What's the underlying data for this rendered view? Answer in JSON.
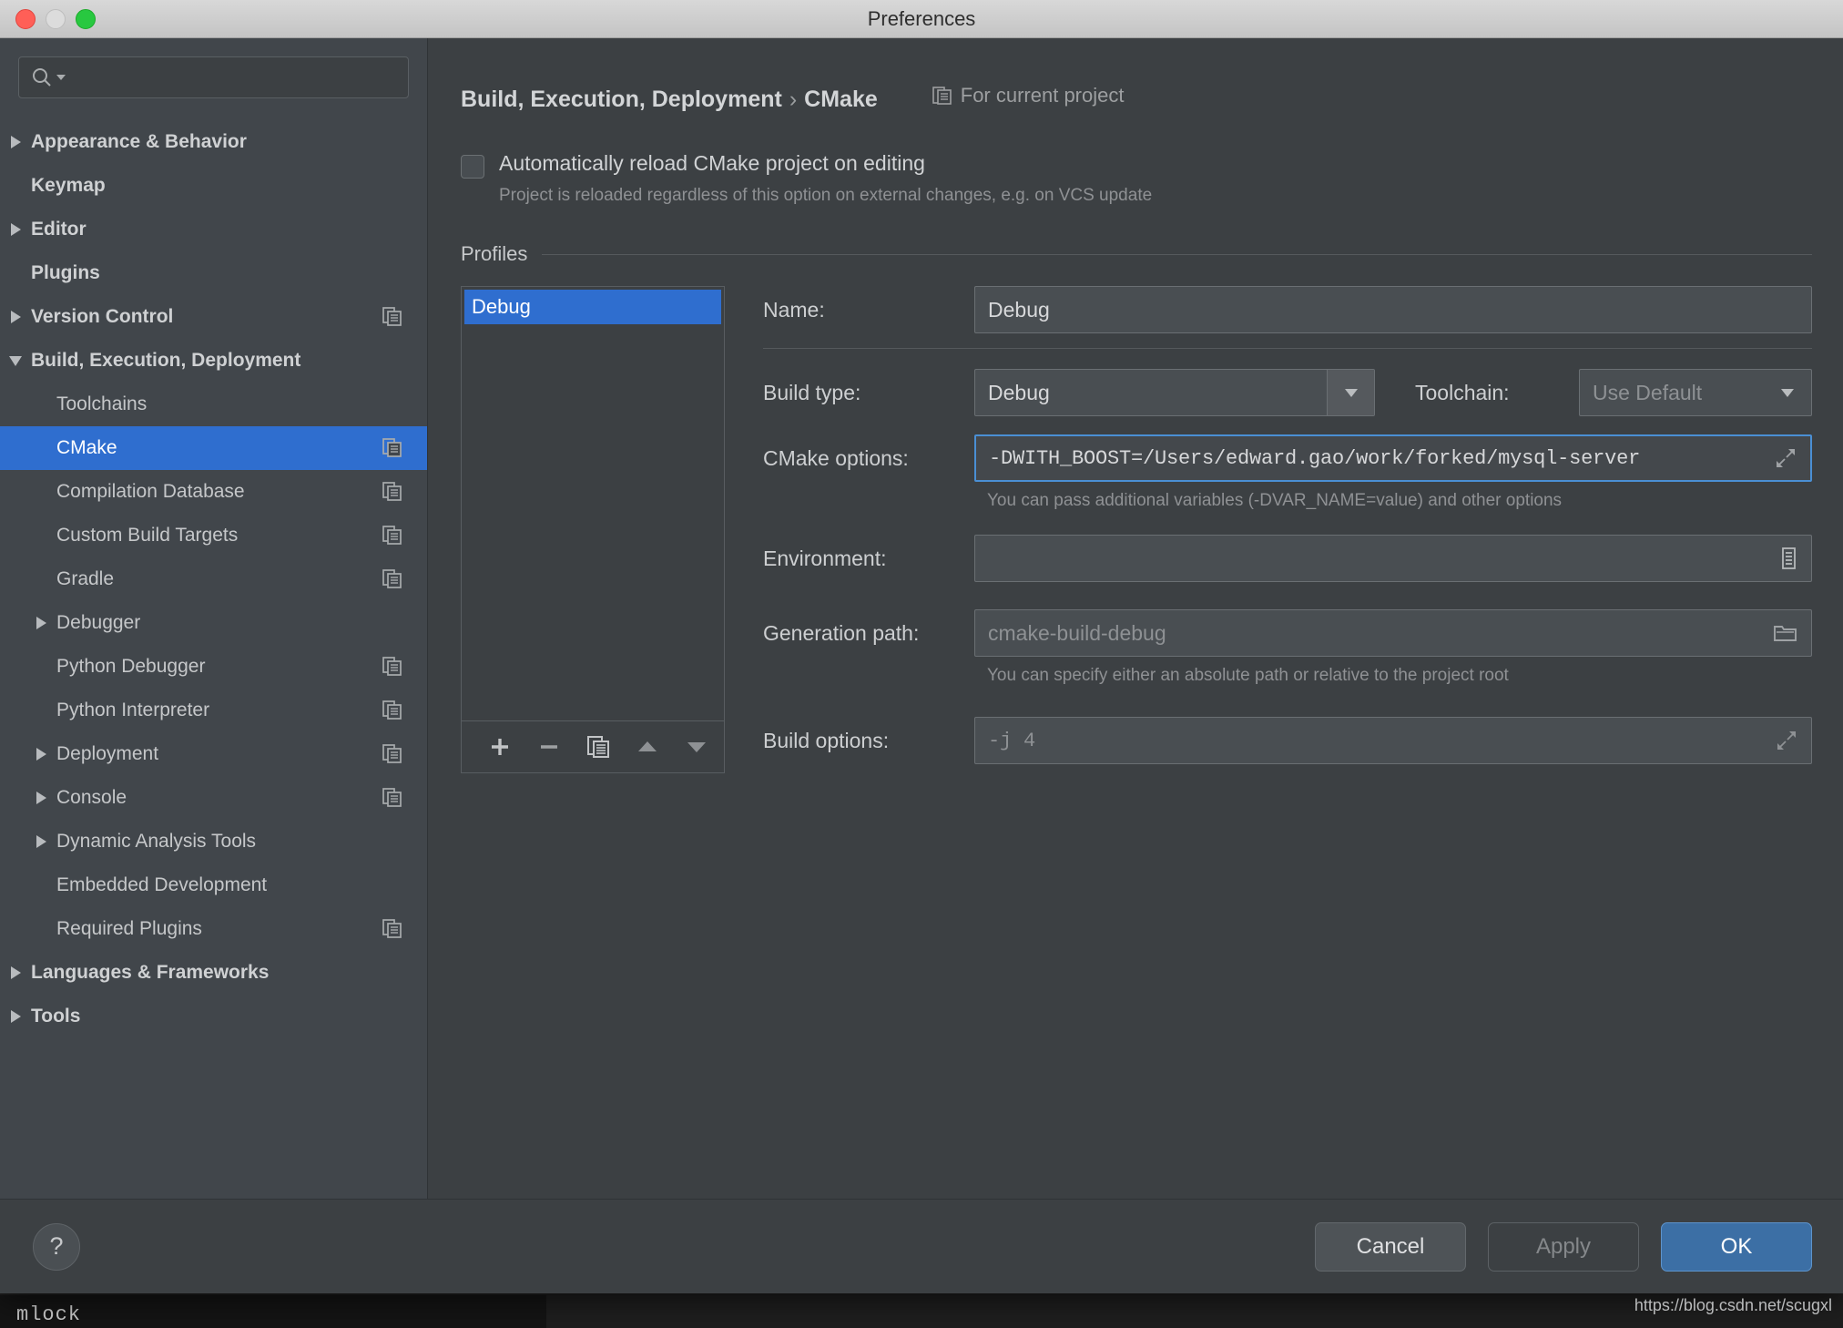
{
  "window": {
    "title": "Preferences",
    "traffic_lights": [
      "close",
      "minimize",
      "zoom"
    ]
  },
  "search": {
    "value": "",
    "placeholder": ""
  },
  "sidebar": {
    "items": [
      {
        "label": "Appearance & Behavior",
        "level": 0,
        "twisty": "right",
        "bold": true,
        "copy": false,
        "selected": false
      },
      {
        "label": "Keymap",
        "level": 0,
        "twisty": "none",
        "bold": true,
        "copy": false,
        "selected": false
      },
      {
        "label": "Editor",
        "level": 0,
        "twisty": "right",
        "bold": true,
        "copy": false,
        "selected": false
      },
      {
        "label": "Plugins",
        "level": 0,
        "twisty": "none",
        "bold": true,
        "copy": false,
        "selected": false
      },
      {
        "label": "Version Control",
        "level": 0,
        "twisty": "right",
        "bold": true,
        "copy": true,
        "selected": false
      },
      {
        "label": "Build, Execution, Deployment",
        "level": 0,
        "twisty": "down",
        "bold": true,
        "copy": false,
        "selected": false
      },
      {
        "label": "Toolchains",
        "level": 1,
        "twisty": "none",
        "bold": false,
        "copy": false,
        "selected": false
      },
      {
        "label": "CMake",
        "level": 1,
        "twisty": "none",
        "bold": false,
        "copy": true,
        "selected": true
      },
      {
        "label": "Compilation Database",
        "level": 1,
        "twisty": "none",
        "bold": false,
        "copy": true,
        "selected": false
      },
      {
        "label": "Custom Build Targets",
        "level": 1,
        "twisty": "none",
        "bold": false,
        "copy": true,
        "selected": false
      },
      {
        "label": "Gradle",
        "level": 1,
        "twisty": "none",
        "bold": false,
        "copy": true,
        "selected": false
      },
      {
        "label": "Debugger",
        "level": 1,
        "twisty": "right",
        "bold": false,
        "copy": false,
        "selected": false
      },
      {
        "label": "Python Debugger",
        "level": 1,
        "twisty": "none",
        "bold": false,
        "copy": true,
        "selected": false
      },
      {
        "label": "Python Interpreter",
        "level": 1,
        "twisty": "none",
        "bold": false,
        "copy": true,
        "selected": false
      },
      {
        "label": "Deployment",
        "level": 1,
        "twisty": "right",
        "bold": false,
        "copy": true,
        "selected": false
      },
      {
        "label": "Console",
        "level": 1,
        "twisty": "right",
        "bold": false,
        "copy": true,
        "selected": false
      },
      {
        "label": "Dynamic Analysis Tools",
        "level": 1,
        "twisty": "right",
        "bold": false,
        "copy": false,
        "selected": false
      },
      {
        "label": "Embedded Development",
        "level": 1,
        "twisty": "none",
        "bold": false,
        "copy": false,
        "selected": false
      },
      {
        "label": "Required Plugins",
        "level": 1,
        "twisty": "none",
        "bold": false,
        "copy": true,
        "selected": false
      },
      {
        "label": "Languages & Frameworks",
        "level": 0,
        "twisty": "right",
        "bold": true,
        "copy": false,
        "selected": false
      },
      {
        "label": "Tools",
        "level": 0,
        "twisty": "right",
        "bold": true,
        "copy": false,
        "selected": false
      }
    ]
  },
  "main": {
    "breadcrumb_parent": "Build, Execution, Deployment",
    "breadcrumb_separator": "›",
    "breadcrumb_current": "CMake",
    "scope_note": "For current project",
    "auto_reload": {
      "label": "Automatically reload CMake project on editing",
      "hint": "Project is reloaded regardless of this option on external changes, e.g. on VCS update",
      "checked": false
    },
    "profiles": {
      "title": "Profiles",
      "list": [
        {
          "name": "Debug",
          "selected": true
        }
      ],
      "toolbar": [
        {
          "name": "add",
          "glyph": "+"
        },
        {
          "name": "remove",
          "glyph": "−"
        },
        {
          "name": "copy",
          "glyph": "copy"
        },
        {
          "name": "move-up",
          "glyph": "up"
        },
        {
          "name": "move-down",
          "glyph": "down"
        }
      ],
      "form": {
        "name_label": "Name:",
        "name_value": "Debug",
        "build_type_label": "Build type:",
        "build_type_value": "Debug",
        "toolchain_label": "Toolchain:",
        "toolchain_value": "Use Default",
        "cmake_options_label": "CMake options:",
        "cmake_options_value": "-DWITH_BOOST=/Users/edward.gao/work/forked/mysql-server",
        "cmake_options_hint": "You can pass additional variables (-DVAR_NAME=value) and other options",
        "environment_label": "Environment:",
        "environment_value": "",
        "generation_path_label": "Generation path:",
        "generation_path_placeholder": "cmake-build-debug",
        "generation_path_hint": "You can specify either an absolute path or relative to the project root",
        "build_options_label": "Build options:",
        "build_options_placeholder": "-j 4"
      }
    }
  },
  "footer": {
    "help_glyph": "?",
    "cancel_label": "Cancel",
    "apply_label": "Apply",
    "ok_label": "OK"
  },
  "background": {
    "terminal_text": "mlock",
    "watermark": "https://blog.csdn.net/scugxl"
  },
  "colors": {
    "accent_blue": "#2f6ecf",
    "primary_button": "#3c6fa5",
    "focus_border": "#4a8fd4",
    "panel_bg": "#3c4043",
    "sidebar_bg": "#41464b",
    "titlebar_bg": "#c4c4c4"
  }
}
